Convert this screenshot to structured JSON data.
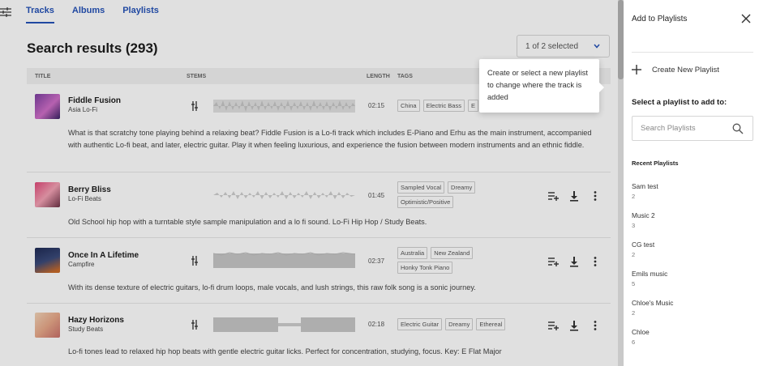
{
  "tabs": [
    {
      "label": "Tracks",
      "active": true
    },
    {
      "label": "Albums",
      "active": false
    },
    {
      "label": "Playlists",
      "active": false
    }
  ],
  "heading": "Search results (293)",
  "selector": {
    "label": "1 of 2 selected"
  },
  "columns": {
    "title": "TITLE",
    "stems": "STEMS",
    "length": "LENGTH",
    "tags": "TAGS"
  },
  "tooltip": {
    "text": "Create or select a new playlist to change where the track is added"
  },
  "tracks": [
    {
      "title": "Fiddle Fusion",
      "artist": "Asia Lo-Fi",
      "length": "02:15",
      "tags": [
        "China",
        "Electric Bass",
        "E"
      ],
      "description": "What is that scratchy tone playing behind a relaxing beat? Fiddle Fusion is a Lo-fi track which includes E-Piano and Erhu as the main instrument, accompanied with authentic Lo-fi beat, and later, electric guitar. Play it when feeling luxurious, and experience the fusion between modern instruments and an ethnic fiddle."
    },
    {
      "title": "Berry Bliss",
      "artist": "Lo-Fi Beats",
      "length": "01:45",
      "tags": [
        "Sampled Vocal",
        "Dreamy",
        "Optimistic/Positive"
      ],
      "description": "Old School hip hop with a turntable style sample manipulation and a lo fi sound. Lo-Fi Hip Hop / Study Beats."
    },
    {
      "title": "Once In A Lifetime",
      "artist": "Campfire",
      "length": "02:37",
      "tags": [
        "Australia",
        "New Zealand",
        "Honky Tonk Piano"
      ],
      "description": "With its dense texture of electric guitars, lo-fi drum loops, male vocals, and lush strings, this raw folk song is a sonic journey."
    },
    {
      "title": "Hazy Horizons",
      "artist": "Study Beats",
      "length": "02:18",
      "tags": [
        "Electric Guitar",
        "Dreamy",
        "Ethereal"
      ],
      "description": "Lo-fi tones lead to relaxed hip hop beats with gentle electric guitar licks. Perfect for concentration, studying, focus. Key: E Flat Major"
    }
  ],
  "panel": {
    "title": "Add to Playlists",
    "create_label": "Create New Playlist",
    "select_label": "Select a playlist to add to:",
    "search_placeholder": "Search Playlists",
    "recent_label": "Recent Playlists",
    "playlists": [
      {
        "name": "Sam test",
        "count": "2"
      },
      {
        "name": "Music 2",
        "count": "3"
      },
      {
        "name": "CG test",
        "count": "2"
      },
      {
        "name": "Emils music",
        "count": "5"
      },
      {
        "name": "Chloe's Music",
        "count": "2"
      },
      {
        "name": "Chloe",
        "count": "6"
      }
    ]
  },
  "colors": {
    "accent": "#2553b8",
    "text": "#1c1c1c",
    "muted": "#555555"
  }
}
